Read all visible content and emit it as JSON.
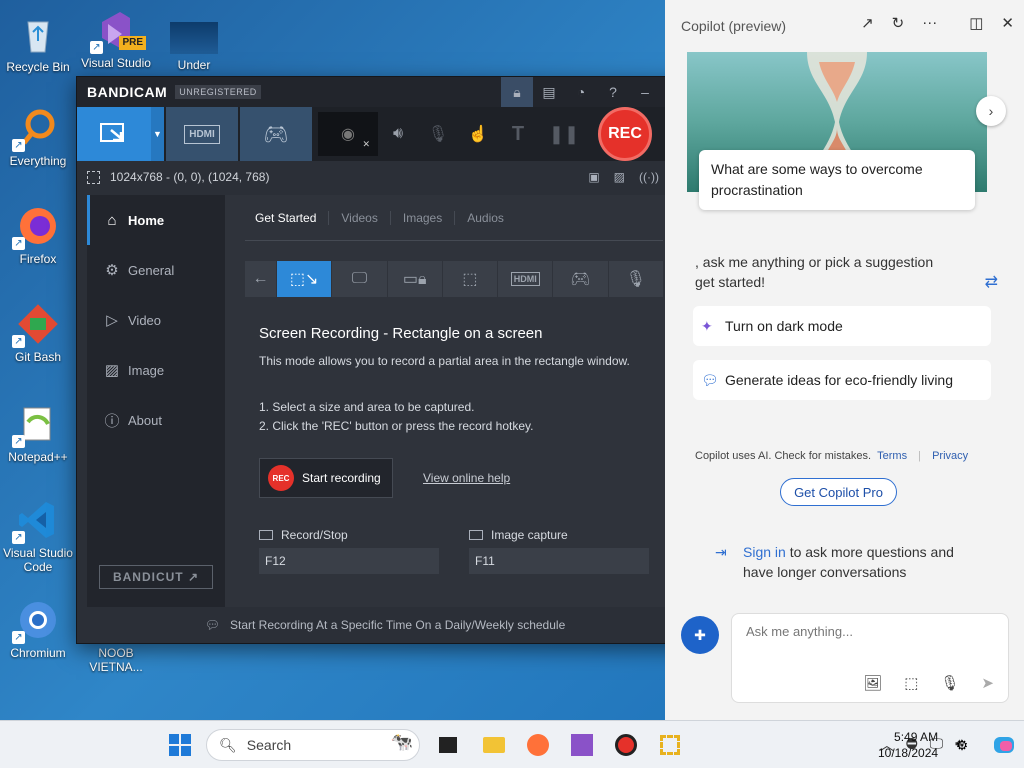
{
  "desktop": {
    "icons": [
      {
        "label": "Recycle Bin"
      },
      {
        "label": "Visual Studio"
      },
      {
        "label": "Under"
      },
      {
        "label": "Everything"
      },
      {
        "label": "Firefox"
      },
      {
        "label": "Git Bash"
      },
      {
        "label": "Notepad++"
      },
      {
        "label": "Visual Studio Code"
      },
      {
        "label": "Chromium"
      },
      {
        "label": "NOOB VIETNA..."
      }
    ],
    "vs_badge": "PRE"
  },
  "bandicam": {
    "logo": "BANDICAM",
    "unregistered": "UNREGISTERED",
    "area_info": "1024x768 - (0, 0), (1024, 768)",
    "rec_label": "REC",
    "sidebar": [
      {
        "label": "Home"
      },
      {
        "label": "General"
      },
      {
        "label": "Video"
      },
      {
        "label": "Image"
      },
      {
        "label": "About"
      }
    ],
    "bandicut": "BANDICUT ↗",
    "tabs": [
      "Get Started",
      "Videos",
      "Images",
      "Audios"
    ],
    "mode_title": "Screen Recording - Rectangle on a screen",
    "mode_desc": "This mode allows you to record a partial area in the rectangle window.",
    "step1": "1. Select a size and area to be captured.",
    "step2": "2. Click the 'REC' button or press the record hotkey.",
    "start_recording": "Start recording",
    "view_help": "View online help",
    "hotkeys": {
      "record_label": "Record/Stop",
      "record_value": "F12",
      "image_label": "Image capture",
      "image_value": "F11"
    },
    "footer": "Start Recording At a Specific Time On a Daily/Weekly schedule"
  },
  "copilot": {
    "title": "Copilot (preview)",
    "hero_question": "What are some ways to overcome procrastination",
    "intro": ", ask me anything or pick a suggestion\nget started!",
    "suggestions": [
      "Turn on dark mode",
      "Generate ideas for eco-friendly living"
    ],
    "disclaimer": "Copilot uses AI. Check for mistakes.",
    "terms": "Terms",
    "privacy": "Privacy",
    "pro_button": "Get Copilot Pro",
    "signin_link": "Sign in",
    "signin_rest": " to ask more questions and have longer conversations",
    "input_placeholder": "Ask me anything..."
  },
  "taskbar": {
    "search": "Search",
    "time": "5:49 AM",
    "date": "10/18/2024"
  }
}
